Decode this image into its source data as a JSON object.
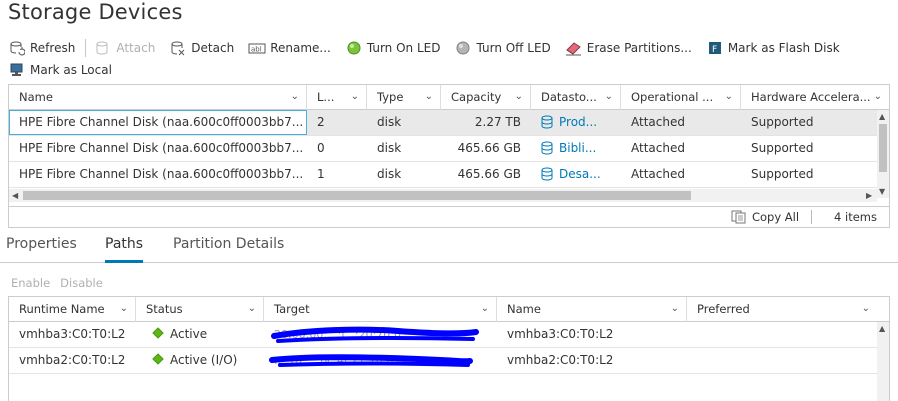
{
  "title": "Storage Devices",
  "toolbar": {
    "row1": [
      {
        "id": "refresh",
        "label": "Refresh",
        "icon": "refresh-icon",
        "enabled": true
      },
      {
        "id": "attach",
        "label": "Attach",
        "icon": "attach-icon",
        "enabled": false
      },
      {
        "id": "detach",
        "label": "Detach",
        "icon": "detach-icon",
        "enabled": true
      },
      {
        "id": "rename",
        "label": "Rename...",
        "icon": "rename-icon",
        "enabled": true
      },
      {
        "id": "turn-on-led",
        "label": "Turn On LED",
        "icon": "led-on-icon",
        "enabled": true
      },
      {
        "id": "turn-off-led",
        "label": "Turn Off LED",
        "icon": "led-off-icon",
        "enabled": true
      },
      {
        "id": "erase-partitions",
        "label": "Erase Partitions...",
        "icon": "eraser-icon",
        "enabled": true
      },
      {
        "id": "mark-flash",
        "label": "Mark as Flash Disk",
        "icon": "flash-disk-icon",
        "enabled": true
      }
    ],
    "row2": [
      {
        "id": "mark-local",
        "label": "Mark as Local",
        "icon": "local-disk-icon",
        "enabled": true
      }
    ]
  },
  "devices_grid": {
    "columns": [
      "Name",
      "L...",
      "Type",
      "Capacity",
      "Datasto...",
      "Operational ...",
      "Hardware Accelera..."
    ],
    "rows": [
      {
        "name": "HPE Fibre Channel Disk (naa.600c0ff0003bb7...",
        "lun": "2",
        "type": "disk",
        "capacity": "2.27 TB",
        "datastore": "Prod...",
        "operational": "Attached",
        "hw_accel": "Supported"
      },
      {
        "name": "HPE Fibre Channel Disk (naa.600c0ff0003bb7...",
        "lun": "0",
        "type": "disk",
        "capacity": "465.66 GB",
        "datastore": "Bibli...",
        "operational": "Attached",
        "hw_accel": "Supported"
      },
      {
        "name": "HPE Fibre Channel Disk (naa.600c0ff0003bb7...",
        "lun": "1",
        "type": "disk",
        "capacity": "465.66 GB",
        "datastore": "Desa...",
        "operational": "Attached",
        "hw_accel": "Supported"
      }
    ],
    "footer": {
      "copy_label": "Copy All",
      "count": "4 items"
    }
  },
  "tabs": [
    {
      "label": "Properties",
      "active": false
    },
    {
      "label": "Paths",
      "active": true
    },
    {
      "label": "Partition Details",
      "active": false
    }
  ],
  "paths_actions": {
    "enable": "Enable",
    "disable": "Disable"
  },
  "paths_grid": {
    "columns": [
      "Runtime Name",
      "Status",
      "Target",
      "Name",
      "Preferred"
    ],
    "rows": [
      {
        "runtime": "vmhba3:C0:T0:L2",
        "status": "Active",
        "target": "20:00:00:...:f...:20:70:0:...",
        "name": "vmhba3:C0:T0:L2",
        "preferred": ""
      },
      {
        "runtime": "vmhba2:C0:T0:L2",
        "status": "Active (I/O)",
        "target": "...:10:...:bc:4f:21:70:0:c...",
        "name": "vmhba2:C0:T0:L2",
        "preferred": ""
      }
    ]
  },
  "colors": {
    "accent": "#0079b8",
    "status_active": "#5eb715",
    "redaction": "#0000ff"
  }
}
